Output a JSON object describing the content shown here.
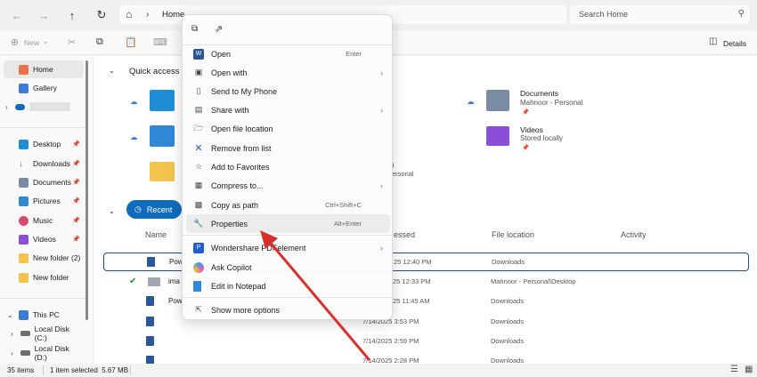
{
  "addressbar": {
    "breadcrumb_home": "Home",
    "search_placeholder": "Search Home"
  },
  "toolbar": {
    "new_label": "New",
    "more_label": "•••",
    "details_label": "Details"
  },
  "sidebar": {
    "items": [
      {
        "label": "Home",
        "icon": "home-icon",
        "color": "#e8734a"
      },
      {
        "label": "Gallery",
        "icon": "gallery-icon",
        "color": "#3a7bd5"
      },
      {
        "label": "",
        "icon": "onedrive-icon",
        "color": "#0f6cbd"
      },
      {
        "label": "Desktop",
        "icon": "desktop-icon",
        "color": "#1f8dd6"
      },
      {
        "label": "Downloads",
        "icon": "downloads-icon",
        "color": "#2a9d6b"
      },
      {
        "label": "Documents",
        "icon": "documents-icon",
        "color": "#7a8ca3"
      },
      {
        "label": "Pictures",
        "icon": "pictures-icon",
        "color": "#2f87d6"
      },
      {
        "label": "Music",
        "icon": "music-icon",
        "color": "#d84a6f"
      },
      {
        "label": "Videos",
        "icon": "videos-icon",
        "color": "#8b4ed6"
      },
      {
        "label": "New folder (2)",
        "icon": "folder-icon",
        "color": "#f2c34d"
      },
      {
        "label": "New folder",
        "icon": "folder-icon",
        "color": "#f2c34d"
      },
      {
        "label": "This PC",
        "icon": "this-pc-icon",
        "color": "#3a7bd5"
      },
      {
        "label": "Local Disk (C:)",
        "icon": "disk-icon",
        "color": "#6d6d6d"
      },
      {
        "label": "Local Disk (D:)",
        "icon": "disk-icon",
        "color": "#6d6d6d"
      }
    ]
  },
  "main": {
    "quick_access_title": "Quick access",
    "qa_documents": {
      "name": "Documents",
      "sub": "Mahnoor - Personal"
    },
    "qa_videos": {
      "name": "Videos",
      "sub": "Stored locally"
    },
    "qa_partial": {
      "line1": ")",
      "line2": "ersonal"
    },
    "recent_tab": "Recent",
    "columns": {
      "name": "Name",
      "accessed": "essed",
      "location": "File location",
      "activity": "Activity"
    },
    "rows": [
      {
        "name": "Pow",
        "date": "25 12:40 PM",
        "location": "Downloads",
        "selected": true
      },
      {
        "name": "ima",
        "date": "25 12:33 PM",
        "location": "Mahnoor - Personal\\Desktop"
      },
      {
        "name": "Pow",
        "date": "25 11:45 AM",
        "location": "Downloads"
      },
      {
        "name": "",
        "date": "7/14/2025 3:53 PM",
        "location": "Downloads"
      },
      {
        "name": "",
        "date": "7/14/2025 2:59 PM",
        "location": "Downloads"
      },
      {
        "name": "",
        "date": "7/14/2025 2:28 PM",
        "location": "Downloads"
      }
    ]
  },
  "context_menu": {
    "items": [
      {
        "label": "Open",
        "key": "Enter",
        "icon": "word-icon"
      },
      {
        "label": "Open with",
        "arrow": true,
        "icon": "open-with-icon"
      },
      {
        "label": "Send to My Phone",
        "icon": "phone-icon"
      },
      {
        "label": "Share with",
        "arrow": true,
        "icon": "share-with-icon"
      },
      {
        "label": "Open file location",
        "icon": "folder-open-icon"
      },
      {
        "label": "Remove from list",
        "icon": "remove-icon"
      },
      {
        "label": "Add to Favorites",
        "icon": "star-icon"
      },
      {
        "label": "Compress to...",
        "arrow": true,
        "icon": "compress-icon"
      },
      {
        "label": "Copy as path",
        "key": "Ctrl+Shift+C",
        "icon": "copy-path-icon"
      },
      {
        "label": "Properties",
        "key": "Alt+Enter",
        "icon": "wrench-icon",
        "active": true
      },
      {
        "label": "Wondershare PDFelement",
        "arrow": true,
        "icon": "pdfelement-icon"
      },
      {
        "label": "Ask Copilot",
        "icon": "copilot-icon"
      },
      {
        "label": "Edit in Notepad",
        "icon": "notepad-icon"
      },
      {
        "label": "Show more options",
        "icon": "more-options-icon"
      }
    ]
  },
  "status": {
    "items_count": "35 items",
    "selection": "1 item selected  5.67 MB"
  },
  "colors": {
    "accent": "#0f6cbd",
    "arrow": "#d9302c",
    "selection_border": "#1f4e8c"
  }
}
